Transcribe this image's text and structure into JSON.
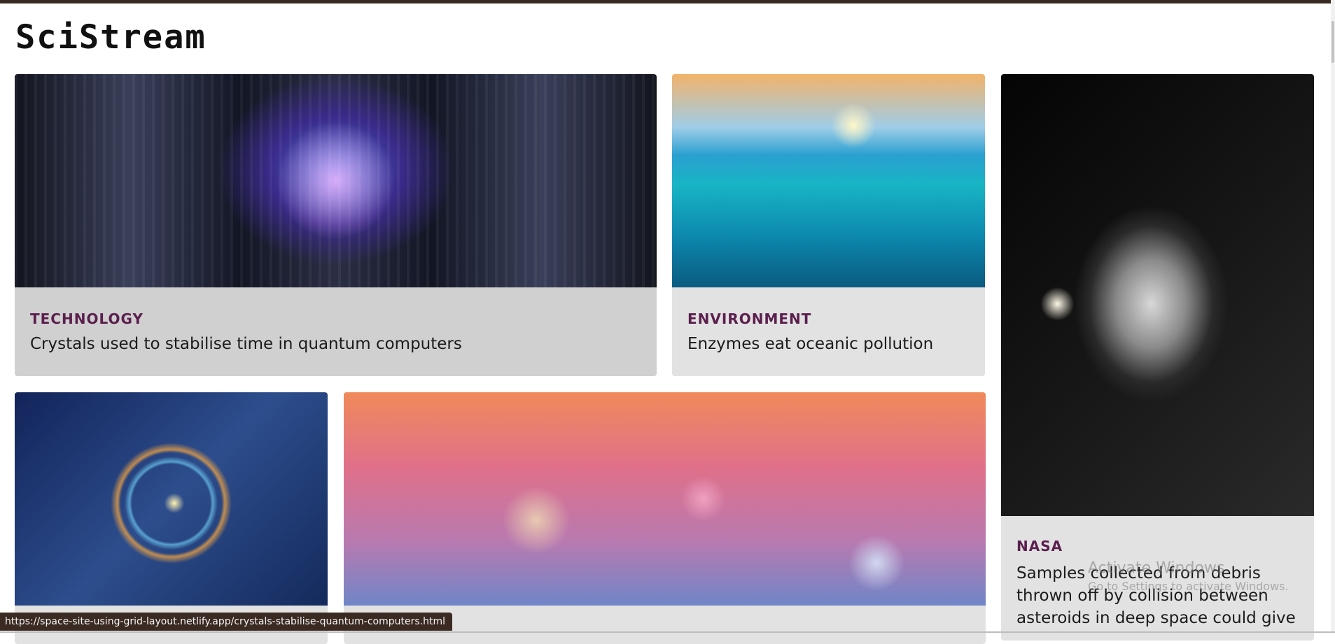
{
  "site": {
    "logo": "SciStream"
  },
  "cards": [
    {
      "category": "TECHNOLOGY",
      "title": "Crystals used to stabilise time in quantum computers",
      "image": "quantum-crystal-image"
    },
    {
      "category": "ENVIRONMENT",
      "title": "Enzymes eat oceanic pollution",
      "image": "ocean-pollution-image"
    },
    {
      "category": "NASA",
      "title": "Samples collected from debris thrown off by collision between asteroids in deep space could give",
      "image": "asteroid-image"
    },
    {
      "image": "physics-equations-image"
    },
    {
      "image": "microbes-image"
    }
  ],
  "status": {
    "url": "https://space-site-using-grid-layout.netlify.app/crystals-stabilise-quantum-computers.html"
  },
  "watermark": {
    "line1": "Activate Windows",
    "line2": "Go to Settings to activate Windows."
  },
  "colors": {
    "accent_category": "#5b1f4e",
    "top_bar": "#3b2a22",
    "card_bg": "#e2e2e2",
    "card_hover_bg": "#d0d0d0"
  }
}
